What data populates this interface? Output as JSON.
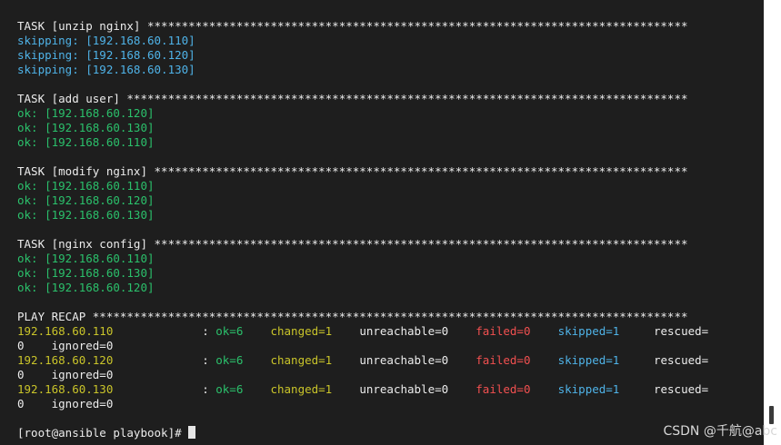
{
  "terminal": {
    "colors": {
      "background": "#1e1e1e",
      "text": "#ececec",
      "skipping": "#4fb3e8",
      "ok": "#2bc06b",
      "host": "#c9c42a",
      "changed": "#c9c42a",
      "failed": "#f25050",
      "skipped": "#4fb3e8"
    },
    "tasks": [
      {
        "header": "TASK [unzip nginx] *******************************************************************************",
        "results": [
          "skipping: [192.168.60.110]",
          "skipping: [192.168.60.120]",
          "skipping: [192.168.60.130]"
        ]
      },
      {
        "header": "TASK [add user] **********************************************************************************",
        "results": [
          "ok: [192.168.60.120]",
          "ok: [192.168.60.130]",
          "ok: [192.168.60.110]"
        ]
      },
      {
        "header": "TASK [modify nginx] ******************************************************************************",
        "results": [
          "ok: [192.168.60.110]",
          "ok: [192.168.60.120]",
          "ok: [192.168.60.130]"
        ]
      },
      {
        "header": "TASK [nginx config] ******************************************************************************",
        "results": [
          "ok: [192.168.60.110]",
          "ok: [192.168.60.130]",
          "ok: [192.168.60.120]"
        ]
      }
    ],
    "recap": {
      "header": "PLAY RECAP ***************************************************************************************",
      "rows": [
        {
          "host": "192.168.60.110",
          "sep": "             : ",
          "ok": "ok=6",
          "changed": "changed=1",
          "unreachable": "unreachable=0",
          "failed": "failed=0",
          "skipped": "skipped=1",
          "rescued": "rescued=",
          "cont": "0    ignored=0"
        },
        {
          "host": "192.168.60.120",
          "sep": "             : ",
          "ok": "ok=6",
          "changed": "changed=1",
          "unreachable": "unreachable=0",
          "failed": "failed=0",
          "skipped": "skipped=1",
          "rescued": "rescued=",
          "cont": "0    ignored=0"
        },
        {
          "host": "192.168.60.130",
          "sep": "             : ",
          "ok": "ok=6",
          "changed": "changed=1",
          "unreachable": "unreachable=0",
          "failed": "failed=0",
          "skipped": "skipped=1",
          "rescued": "rescued=",
          "cont": "0    ignored=0"
        }
      ]
    },
    "prompt": "[root@ansible playbook]# "
  },
  "watermark": "CSDN @千航@abc"
}
